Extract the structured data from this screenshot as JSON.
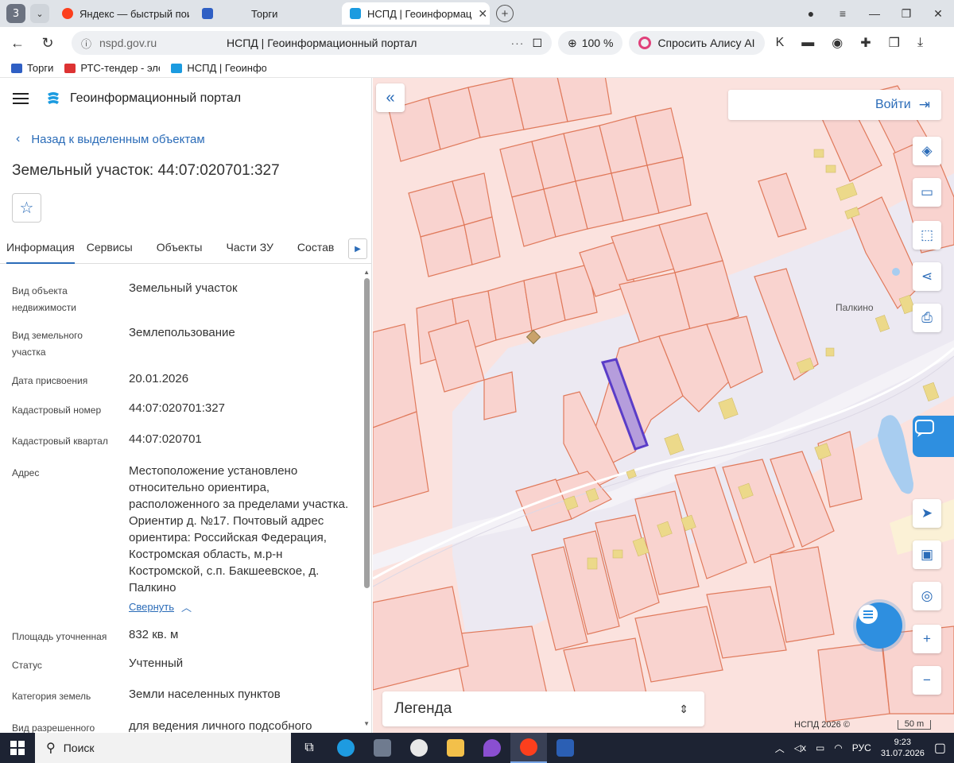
{
  "browser": {
    "tab_count": "3",
    "tabs": [
      {
        "label": "Яндекс — быстрый поиск",
        "color": "#fc3f1d"
      },
      {
        "label": "Торги",
        "color": "#2f5fc4"
      },
      {
        "label": "НСПД | Геоинформац",
        "color": "#1b9be0"
      }
    ],
    "domain": "nspd.gov.ru",
    "page_title": "НСПД | Геоинформационный портал",
    "zoom": "100 %",
    "alice": "Спросить Алису AI",
    "bookmarks": [
      "Торги",
      "РТС-тендер - эле",
      "НСПД | Геоинфор"
    ]
  },
  "panel": {
    "title": "Геоинформационный портал",
    "back": "Назад к выделенным объектам",
    "object_title": "Земельный участок: 44:07:020701:327",
    "tabs": [
      "Информация",
      "Сервисы",
      "Объекты",
      "Части ЗУ",
      "Состав"
    ],
    "rows": [
      {
        "key": "Вид объекта недвижимости",
        "value": "Земельный участок"
      },
      {
        "key": "Вид земельного участка",
        "value": "Землепользование"
      },
      {
        "key": "Дата присвоения",
        "value": "20.01.2026"
      },
      {
        "key": "Кадастровый номер",
        "value": "44:07:020701:327"
      },
      {
        "key": "Кадастровый квартал",
        "value": "44:07:020701"
      },
      {
        "key": "Адрес",
        "value": "Местоположение установлено относительно ориентира, расположенного за пределами участка. Ориентир д. №17. Почтовый адрес ориентира: Российская Федерация, Костромская область, м.р-н Костромской, с.п. Бакшеевское, д. Палкино"
      },
      {
        "key": "Площадь уточненная",
        "value": "832 кв. м"
      },
      {
        "key": "Статус",
        "value": "Учтенный"
      },
      {
        "key": "Категория земель",
        "value": "Земли населенных пунктов"
      },
      {
        "key": "Вид разрешенного",
        "value": "для ведения личного подсобного"
      }
    ],
    "collapse": "Свернуть"
  },
  "map": {
    "login": "Войти",
    "place": "Палкино",
    "legend": "Легенда",
    "copyright": "НСПД 2026 ©",
    "scale": "50 m",
    "colors": {
      "parcel_fill": "#f9d3cf",
      "parcel_stroke": "#e07a5c",
      "road": "#ece9f2",
      "building": "#ecd98a",
      "selected": "#7a5cc8",
      "water": "#a8cdf0"
    }
  },
  "taskbar": {
    "search": "Поиск",
    "lang": "РУС",
    "time": "9:23",
    "date": "31.07.2026"
  }
}
